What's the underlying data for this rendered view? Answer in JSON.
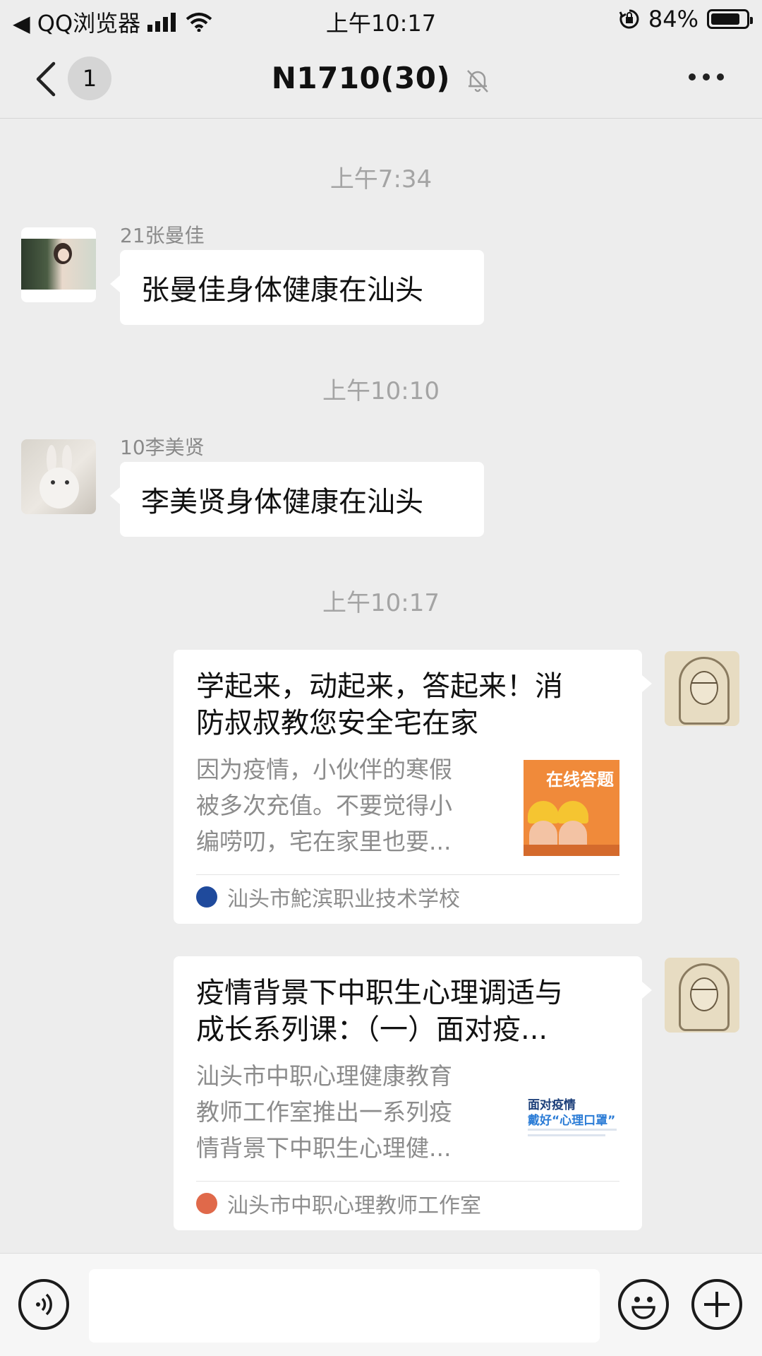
{
  "status_bar": {
    "back_app_label": "◀ QQ浏览器",
    "time": "上午10:17",
    "battery_text": "84%",
    "battery_level": 0.84,
    "icons": [
      "signal-icon",
      "wifi-icon",
      "orientation-lock-icon",
      "battery-icon"
    ]
  },
  "nav": {
    "unread_count": "1",
    "title": "N1710(30)",
    "muted": true,
    "icons": [
      "back-chevron-icon",
      "bell-muted-icon",
      "more-dots-icon"
    ]
  },
  "messages": [
    {
      "type": "timestamp",
      "text": "上午7:34"
    },
    {
      "type": "text",
      "sender": "21张曼佳",
      "text": "张曼佳身体健康在汕头"
    },
    {
      "type": "timestamp",
      "text": "上午10:10"
    },
    {
      "type": "text",
      "sender": "10李美贤",
      "text": "李美贤身体健康在汕头"
    },
    {
      "type": "timestamp",
      "text": "上午10:17"
    },
    {
      "type": "link",
      "title_lines": [
        "学起来，动起来，答起来！消",
        "防叔叔教您安全宅在家"
      ],
      "desc_lines": [
        "因为疫情，小伙伴的寒假",
        "被多次充值。不要觉得小",
        "编唠叨，宅在家里也要..."
      ],
      "thumb_text": "在线答题",
      "source": "汕头市鮀滨职业技术学校"
    },
    {
      "type": "link",
      "title_lines": [
        "疫情背景下中职生心理调适与",
        "成长系列课：（一）面对疫..."
      ],
      "desc_lines": [
        "汕头市中职心理健康教育",
        "教师工作室推出一系列疫",
        "情背景下中职生心理健..."
      ],
      "thumb_text_1": "面对疫情",
      "thumb_text_2": "戴好“心理口罩”",
      "source": "汕头市中职心理教师工作室"
    }
  ],
  "input_bar": {
    "input_value": "",
    "icons": [
      "voice-icon",
      "emoji-icon",
      "plus-icon"
    ]
  },
  "colors": {
    "background": "#ededed",
    "bubble": "#ffffff",
    "timestamp": "#a4a4a4",
    "secondary_text": "#8c8c8c"
  }
}
